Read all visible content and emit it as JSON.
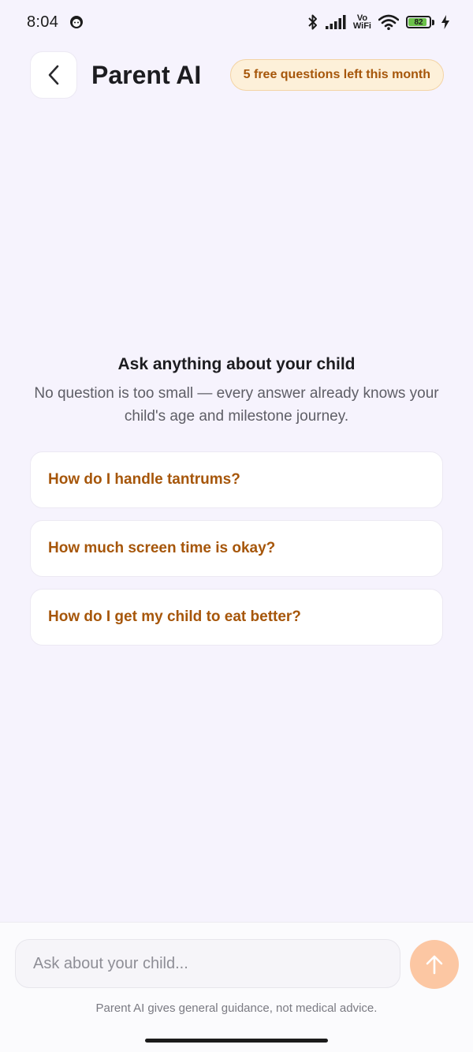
{
  "status_bar": {
    "time": "8:04",
    "battery_level": "82",
    "network_label_top": "Vo",
    "network_label_bottom": "WiFi",
    "battery_color": "#6cc24a"
  },
  "header": {
    "title": "Parent AI",
    "quota_badge": "5 free questions left this month",
    "back_icon": "chevron-left-icon"
  },
  "empty_state": {
    "title": "Ask anything about your child",
    "subtitle": "No question is too small — every answer already knows your child's age and milestone journey."
  },
  "suggestions": [
    "How do I handle tantrums?",
    "How much screen time is okay?",
    "How do I get my child to eat better?"
  ],
  "composer": {
    "placeholder": "Ask about your child...",
    "value": "",
    "send_icon": "arrow-up-icon",
    "disclaimer": "Parent AI gives general guidance, not medical advice."
  },
  "colors": {
    "background": "#f6f3fd",
    "accent": "#a6560a",
    "badge_bg": "#fdf0d9",
    "send_button": "#fcc7a3"
  }
}
